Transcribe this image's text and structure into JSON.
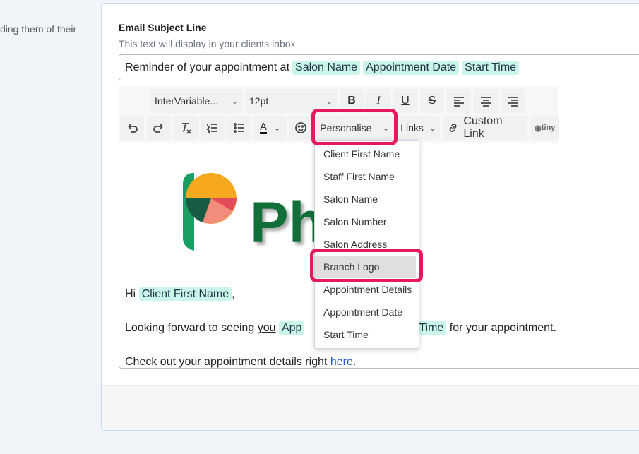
{
  "left_help_text": "ding them of their",
  "subject": {
    "label": "Email Subject Line",
    "help": "This text will display in your clients inbox",
    "text": "Reminder of your appointment at",
    "tags": [
      "Salon Name",
      "Appointment Date",
      "Start Time"
    ]
  },
  "toolbar": {
    "font_family": "InterVariable...",
    "font_size": "12pt",
    "bold": "B",
    "italic": "I",
    "underline": "U",
    "strike": "S",
    "personalise": "Personalise",
    "links": "Links",
    "custom_link": "Custom Link",
    "tiny": "tiny",
    "text_color_letter": "A"
  },
  "editor": {
    "logo_text": "Ph          t",
    "greeting_prefix": "Hi",
    "greeting_tag": "Client First Name",
    "greeting_suffix": ",",
    "line2_prefix": "Looking forward to seeing",
    "line2_you": "you",
    "line2_tag1_partial": "App",
    "line2_tag2_partial": "rt Time",
    "line2_suffix": "for your appointment.",
    "line3_prefix": "Check out your appointment details right",
    "line3_link": "here",
    "line3_suffix": "."
  },
  "dropdown": {
    "items": [
      "Client First Name",
      "Staff First Name",
      "Salon Name",
      "Salon Number",
      "Salon Address",
      "Branch Logo",
      "Appointment Details",
      "Appointment Date",
      "Start Time"
    ],
    "active": "Branch Logo"
  },
  "colors": {
    "highlight": "#e8185e",
    "tag_bg": "#c9f5ea",
    "logo_green": "#136f3a",
    "link": "#2457c5"
  }
}
